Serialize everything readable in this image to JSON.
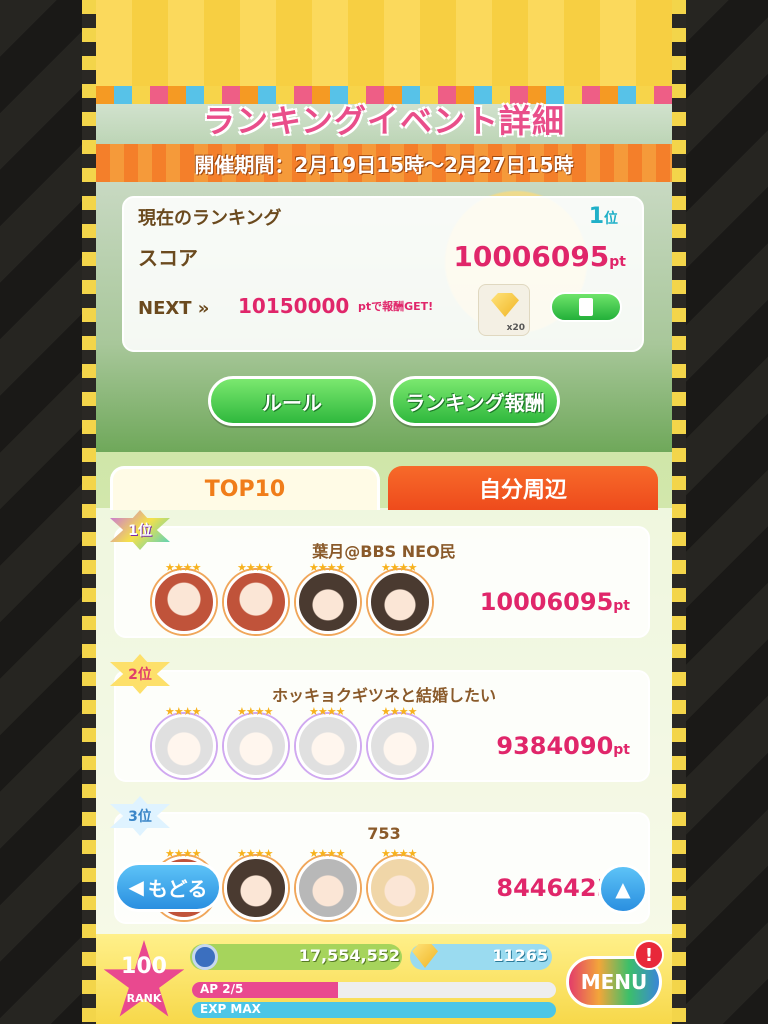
{
  "header": {
    "title": "ランキングイベント詳細",
    "period": "開催期間：2月19日15時～2月27日15時"
  },
  "ranking_panel": {
    "current_label": "現在のランキング",
    "current_rank": "1",
    "rank_suffix": "位",
    "score_label": "スコア",
    "score": "10006095",
    "pt": "pt",
    "next_label": "NEXT »",
    "next_value": "10150000",
    "next_suffix": "ptで報酬GET!",
    "reward_qty": "x20"
  },
  "buttons": {
    "rules": "ルール",
    "ranking_rewards": "ランキング報酬",
    "back": "もどる",
    "menu": "MENU"
  },
  "tabs": [
    {
      "label": "TOP10",
      "active": true
    },
    {
      "label": "自分周辺",
      "active": false
    }
  ],
  "entries": [
    {
      "badge": "1位",
      "player": "葉月@BBS NEO民",
      "points": "10006095",
      "stars": "★★★★"
    },
    {
      "badge": "2位",
      "player": "ホッキョクギツネと結婚したい",
      "points": "9384090",
      "stars": "★★★★"
    },
    {
      "badge": "3位",
      "player": "753",
      "points": "8446423",
      "stars": "★★★★"
    }
  ],
  "status_bar": {
    "player_rank": "100",
    "rank_label": "RANK",
    "coins": "17,554,552",
    "gems": "11265",
    "ap_label": "AP 2/5",
    "ap_fraction": 0.4,
    "exp_label": "EXP MAX",
    "exp_fraction": 1.0,
    "alert": "!"
  },
  "colors": {
    "accent_pink": "#e0266a",
    "accent_green": "#2fb83d",
    "accent_orange": "#f07d1a",
    "accent_blue": "#2a8fe0"
  },
  "icons": [
    "back-arrow-icon",
    "up-arrow-icon",
    "document-icon",
    "gem-icon",
    "coin-icon",
    "star-icon"
  ]
}
